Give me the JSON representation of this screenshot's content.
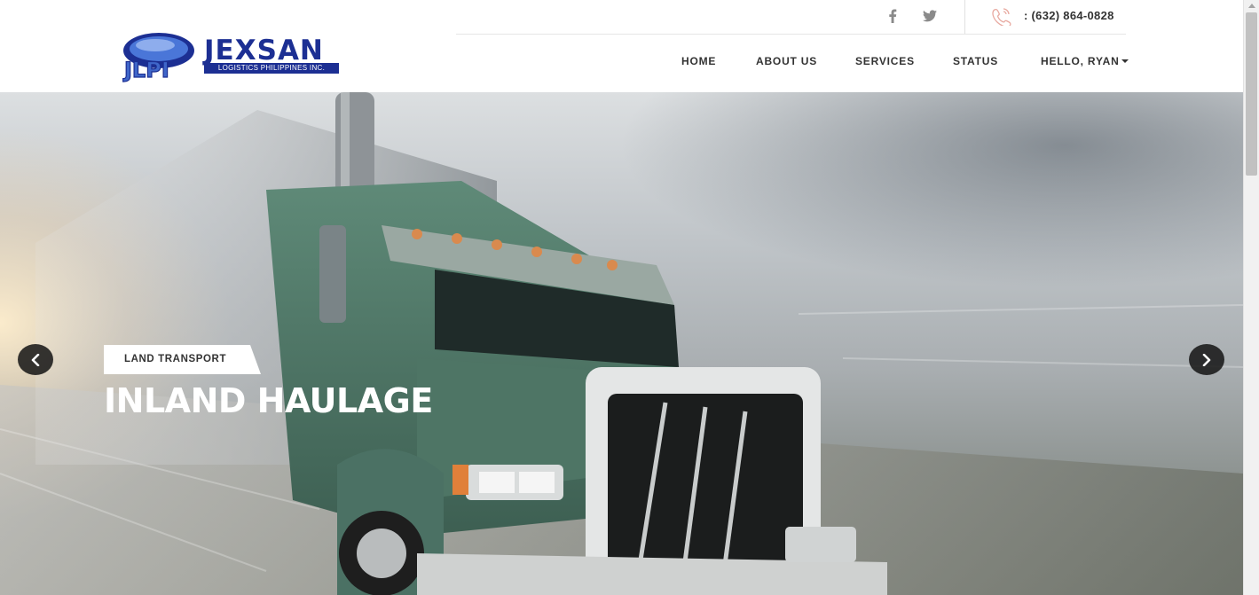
{
  "brand": {
    "name": "JEXSAN",
    "tagline": "LOGISTICS PHILIPPINES INC.",
    "mark": "JLPI",
    "color": "#1c2f93"
  },
  "topbar": {
    "social": [
      {
        "icon": "facebook-icon"
      },
      {
        "icon": "twitter-icon"
      }
    ],
    "phone_icon": "phone-icon",
    "phone": ": (632) 864-0828"
  },
  "nav": {
    "items": [
      {
        "label": "HOME"
      },
      {
        "label": "ABOUT US"
      },
      {
        "label": "SERVICES"
      },
      {
        "label": "STATUS"
      }
    ],
    "user_menu": {
      "label": "HELLO, RYAN"
    }
  },
  "hero": {
    "category": "LAND TRANSPORT",
    "headline": "INLAND HAULAGE",
    "prev_icon": "chevron-left-icon",
    "next_icon": "chevron-right-icon"
  },
  "colors": {
    "accent": "#1c2f93",
    "text": "#333333"
  }
}
